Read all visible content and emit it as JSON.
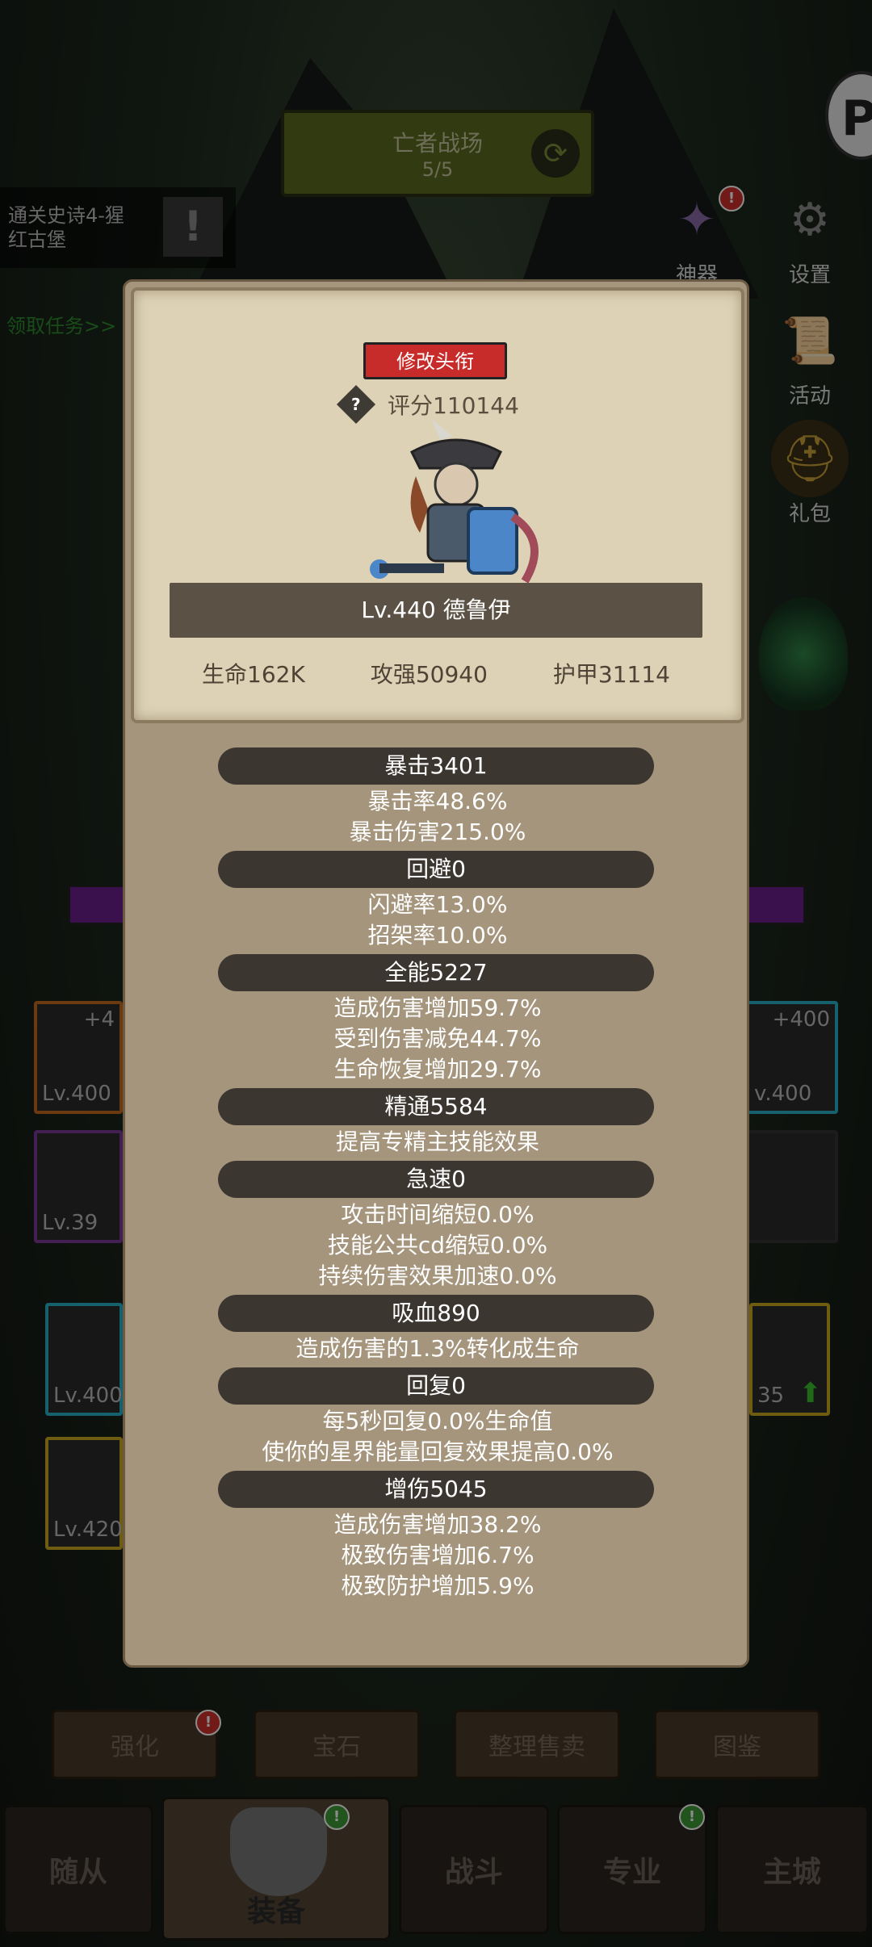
{
  "banner": {
    "title": "亡者战场",
    "progress": "5/5"
  },
  "quest": {
    "text_line1": "通关史诗4-猩",
    "text_line2": "红古堡",
    "link": "领取任务>>"
  },
  "side_buttons": [
    {
      "label": "神器"
    },
    {
      "label": "设置"
    },
    {
      "label": "活动"
    },
    {
      "label": "礼包"
    }
  ],
  "bg_slots": {
    "left_top": {
      "plus": "+4",
      "lv": "Lv.400"
    },
    "left_mid": {
      "lv": "Lv.39"
    },
    "right_top": {
      "plus": "+400",
      "lv": "v.400"
    },
    "lower_left1": {
      "lv": "Lv.400"
    },
    "lower_left2": {
      "lv": "Lv.420"
    },
    "lower_right1": {
      "lv": "35"
    }
  },
  "bottom_buttons": [
    "强化",
    "宝石",
    "整理售卖",
    "图鉴"
  ],
  "nav": [
    "随从",
    "装备",
    "战斗",
    "专业",
    "主城"
  ],
  "modal": {
    "title_button": "修改头衔",
    "help": "?",
    "score": "评分110144",
    "name": "Lv.440 德鲁伊",
    "stats": [
      "生命162K",
      "攻强50940",
      "护甲31114"
    ],
    "sections": [
      {
        "header": "暴击3401",
        "lines": [
          "暴击率48.6%",
          "暴击伤害215.0%"
        ]
      },
      {
        "header": "回避0",
        "lines": [
          "闪避率13.0%",
          "招架率10.0%"
        ]
      },
      {
        "header": "全能5227",
        "lines": [
          "造成伤害增加59.7%",
          "受到伤害减免44.7%",
          "生命恢复增加29.7%"
        ]
      },
      {
        "header": "精通5584",
        "lines": [
          "提高专精主技能效果"
        ]
      },
      {
        "header": "急速0",
        "lines": [
          "攻击时间缩短0.0%",
          "技能公共cd缩短0.0%",
          "持续伤害效果加速0.0%"
        ]
      },
      {
        "header": "吸血890",
        "lines": [
          "造成伤害的1.3%转化成生命"
        ]
      },
      {
        "header": "回复0",
        "lines": [
          "每5秒回复0.0%生命值",
          "使你的星界能量回复效果提高0.0%"
        ]
      },
      {
        "header": "增伤5045",
        "lines": [
          "造成伤害增加38.2%",
          "极致伤害增加6.7%",
          "极致防护增加5.9%"
        ]
      }
    ]
  },
  "colors": {
    "title_button": "#c82c2a",
    "modal": "#a5957c",
    "banner": "#5a6a1e"
  }
}
